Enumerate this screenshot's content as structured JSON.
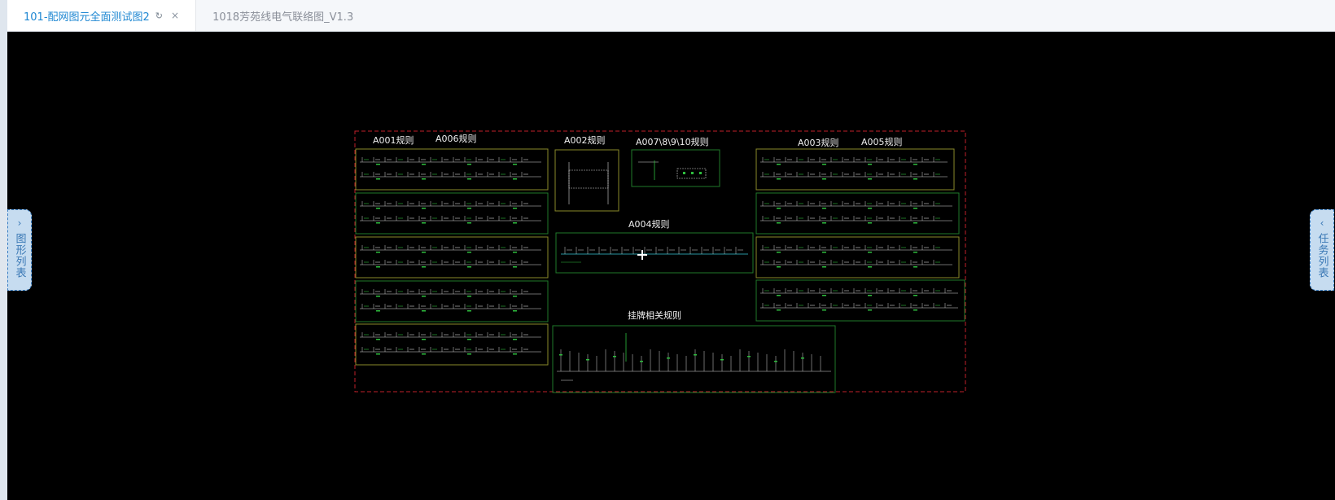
{
  "tabs": [
    {
      "label": "101-配网图元全面测试图2",
      "active": true,
      "refresh_icon": "refresh-icon",
      "close_icon": "close-icon"
    },
    {
      "label": "1018芳苑线电气联络图_V1.3",
      "active": false
    }
  ],
  "left_panel": {
    "label": "图形列表",
    "icon": "chevron-right-icon"
  },
  "right_panel": {
    "label": "任务列表",
    "icon": "chevron-left-icon"
  },
  "diagram": {
    "labels": {
      "a001": "A001规则",
      "a006": "A006规则",
      "a002": "A002规则",
      "a007": "A007\\8\\9\\10规则",
      "a003": "A003规则",
      "a005": "A005规则",
      "a004": "A004规则",
      "guapai": "挂牌相关规则"
    },
    "colors": {
      "background": "#000000",
      "border_dashed": "#c0202a",
      "box_olive": "#8a8a2a",
      "box_green": "#1f7a2a",
      "line_white": "#d8d8d8",
      "line_green": "#2fbf3f",
      "line_cyan": "#35c6d6"
    }
  }
}
